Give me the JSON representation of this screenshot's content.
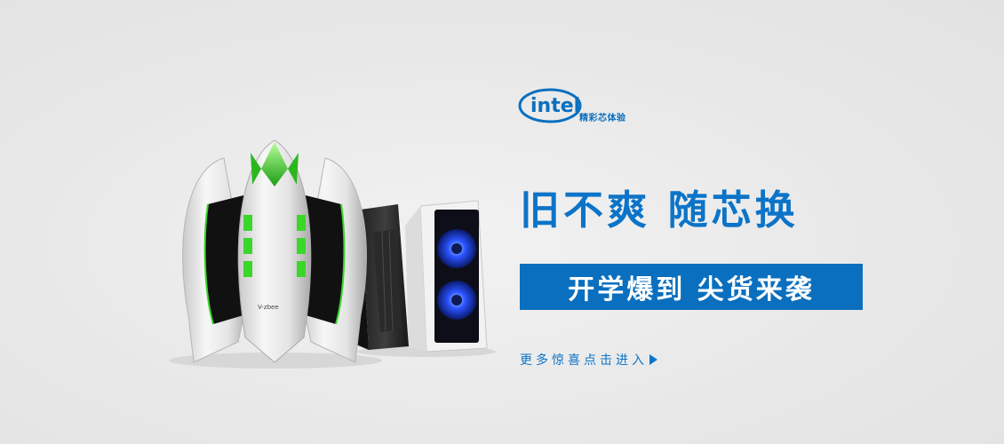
{
  "brand": {
    "logo_text": "intel",
    "slogan": "精彩芯体验",
    "brand_color": "#0a6fbe"
  },
  "promo": {
    "headline": "旧不爽 随芯换",
    "subheadline": "开学爆到 尖货来袭",
    "cta_label": "更多惊喜点击进入"
  },
  "product_image": {
    "case_label": "V-zbee"
  },
  "colors": {
    "accent_blue": "#0c74c8",
    "bar_blue": "#0a6fbe",
    "background": "#eaeaea",
    "case_green": "#3ad62a"
  }
}
